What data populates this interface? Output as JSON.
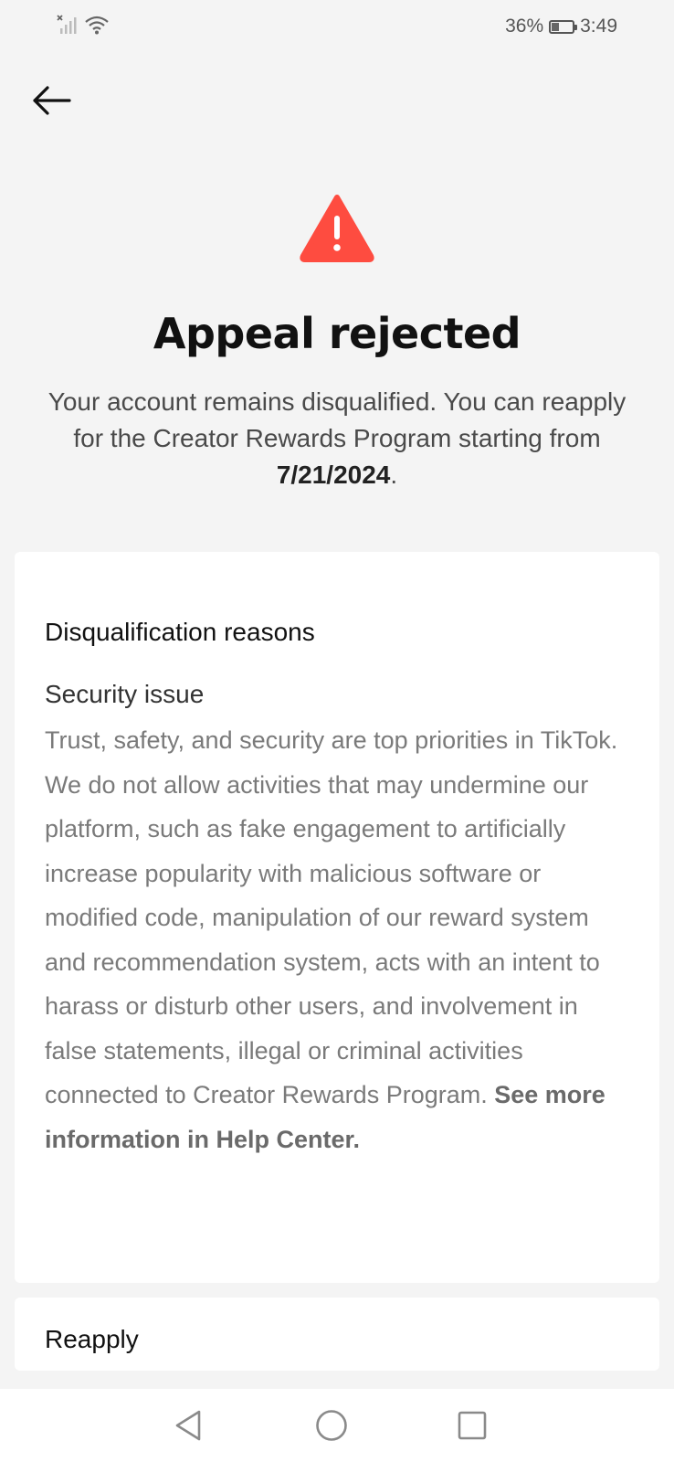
{
  "status_bar": {
    "battery_percent": "36%",
    "battery_level": 0.36,
    "time": "3:49",
    "icons": [
      "no-signal-icon",
      "wifi-icon",
      "battery-icon"
    ]
  },
  "header": {
    "back_icon": "arrow-left-icon"
  },
  "hero": {
    "icon": "warning-triangle-icon",
    "icon_color": "#fe4c40",
    "title": "Appeal rejected",
    "subtitle_prefix": "Your account remains disqualified. You can reapply for the Creator Rewards Program starting from ",
    "subtitle_date": "7/21/2024",
    "subtitle_suffix": "."
  },
  "reasons_card": {
    "heading": "Disqualification reasons",
    "reason_title": "Security issue",
    "reason_body": "Trust, safety, and security are top priorities in TikTok. We do not allow activities that may undermine our platform, such as fake engagement to artificially increase popularity with malicious software or modified code, manipulation of our reward system and recommendation system, acts with an intent to harass or disturb other users, and involvement in false statements, illegal or criminal activities connected to Creator Rewards Program. ",
    "help_link": "See more information in Help Center."
  },
  "reapply_card": {
    "heading": "Reapply"
  },
  "nav_bar": {
    "buttons": [
      "back-triangle-icon",
      "home-circle-icon",
      "recents-square-icon"
    ]
  }
}
